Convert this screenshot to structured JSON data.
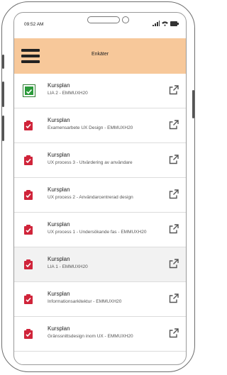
{
  "status": {
    "time": "09:52 AM"
  },
  "header": {
    "title": "Enkäter"
  },
  "items": [
    {
      "title": "Kursplan",
      "subtitle": "LIA 2 - EMMUXH20",
      "state": "done"
    },
    {
      "title": "Kursplan",
      "subtitle": "Examensarbete UX Design - EMMUXH20",
      "state": "todo"
    },
    {
      "title": "Kursplan",
      "subtitle": "UX process 3 - Utvärdering av användare",
      "state": "todo"
    },
    {
      "title": "Kursplan",
      "subtitle": "UX process 2 - Användarcentrerad design",
      "state": "todo"
    },
    {
      "title": "Kursplan",
      "subtitle": "UX process 1 - Undersökande fas - EMMUXH20",
      "state": "todo"
    },
    {
      "title": "Kursplan",
      "subtitle": "LIA 1 - EMMUXH20",
      "state": "todo"
    },
    {
      "title": "Kursplan",
      "subtitle": "Informationsarkitektur - EMMUXH20",
      "state": "todo"
    },
    {
      "title": "Kursplan",
      "subtitle": "Gränssnittsdesign inom UX - EMMUXH20",
      "state": "todo"
    }
  ],
  "colors": {
    "header_bg": "#f7c89a",
    "todo_icon": "#d0243a",
    "done_icon": "#2a9a3a"
  }
}
